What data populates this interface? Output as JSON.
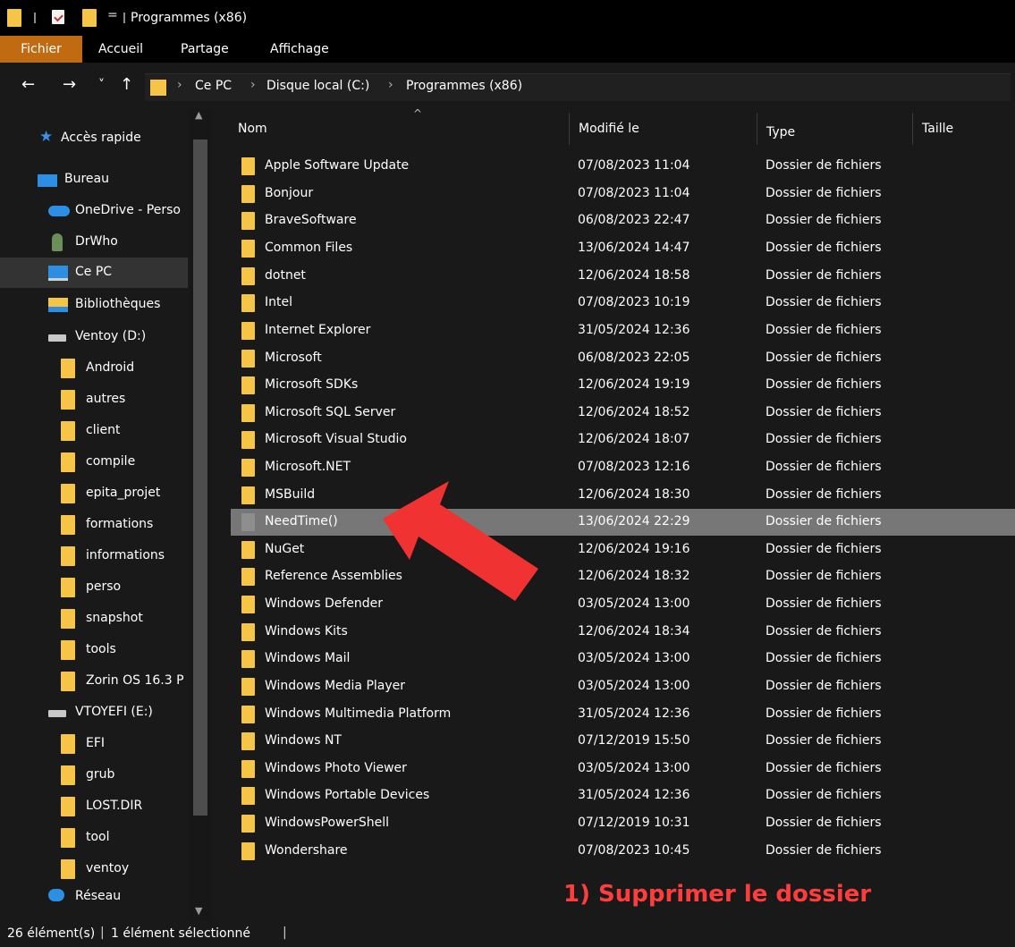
{
  "window": {
    "title": "Programmes (x86)",
    "qa_dropdown": "="
  },
  "ribbon": {
    "tabs": [
      "Fichier",
      "Accueil",
      "Partage",
      "Affichage"
    ]
  },
  "nav": {
    "back": "←",
    "forward": "→",
    "recent": "˅",
    "up": "↑"
  },
  "address": {
    "crumbs": [
      "Ce PC",
      "Disque local (C:)",
      "Programmes (x86)"
    ],
    "separator": "›"
  },
  "sidebar": {
    "items": [
      {
        "label": "Accès rapide",
        "icon": "star-icon"
      },
      {
        "label": "Bureau",
        "icon": "desktop-icon"
      },
      {
        "label": "OneDrive - Perso",
        "icon": "cloud-icon"
      },
      {
        "label": "DrWho",
        "icon": "user-icon"
      },
      {
        "label": "Ce PC",
        "icon": "computer-icon",
        "selected": true
      },
      {
        "label": "Bibliothèques",
        "icon": "library-icon"
      },
      {
        "label": "Ventoy (D:)",
        "icon": "drive-icon"
      },
      {
        "label": "Android",
        "icon": "folder-icon"
      },
      {
        "label": "autres",
        "icon": "folder-icon"
      },
      {
        "label": "client",
        "icon": "folder-icon"
      },
      {
        "label": "compile",
        "icon": "folder-icon"
      },
      {
        "label": "epita_projet",
        "icon": "folder-icon"
      },
      {
        "label": "formations",
        "icon": "folder-icon"
      },
      {
        "label": "informations",
        "icon": "folder-icon"
      },
      {
        "label": "perso",
        "icon": "folder-icon"
      },
      {
        "label": "snapshot",
        "icon": "folder-icon"
      },
      {
        "label": "tools",
        "icon": "folder-icon"
      },
      {
        "label": "Zorin OS 16.3 P",
        "icon": "folder-icon"
      },
      {
        "label": "VTOYEFI (E:)",
        "icon": "drive-icon"
      },
      {
        "label": "EFI",
        "icon": "folder-icon"
      },
      {
        "label": "grub",
        "icon": "folder-icon"
      },
      {
        "label": "LOST.DIR",
        "icon": "folder-icon"
      },
      {
        "label": "tool",
        "icon": "folder-icon"
      },
      {
        "label": "ventoy",
        "icon": "folder-icon"
      },
      {
        "label": "Réseau",
        "icon": "network-icon"
      }
    ]
  },
  "columns": {
    "name": "Nom",
    "modified": "Modifié le",
    "type": "Type",
    "size": "Taille"
  },
  "files": [
    {
      "name": "Apple Software Update",
      "date": "07/08/2023 11:04",
      "type": "Dossier de fichiers"
    },
    {
      "name": "Bonjour",
      "date": "07/08/2023 11:04",
      "type": "Dossier de fichiers"
    },
    {
      "name": "BraveSoftware",
      "date": "06/08/2023 22:47",
      "type": "Dossier de fichiers"
    },
    {
      "name": "Common Files",
      "date": "13/06/2024 14:47",
      "type": "Dossier de fichiers"
    },
    {
      "name": "dotnet",
      "date": "12/06/2024 18:58",
      "type": "Dossier de fichiers"
    },
    {
      "name": "Intel",
      "date": "07/08/2023 10:19",
      "type": "Dossier de fichiers"
    },
    {
      "name": "Internet Explorer",
      "date": "31/05/2024 12:36",
      "type": "Dossier de fichiers"
    },
    {
      "name": "Microsoft",
      "date": "06/08/2023 22:05",
      "type": "Dossier de fichiers"
    },
    {
      "name": "Microsoft SDKs",
      "date": "12/06/2024 19:19",
      "type": "Dossier de fichiers"
    },
    {
      "name": "Microsoft SQL Server",
      "date": "12/06/2024 18:52",
      "type": "Dossier de fichiers"
    },
    {
      "name": "Microsoft Visual Studio",
      "date": "12/06/2024 18:07",
      "type": "Dossier de fichiers"
    },
    {
      "name": "Microsoft.NET",
      "date": "07/08/2023 12:16",
      "type": "Dossier de fichiers"
    },
    {
      "name": "MSBuild",
      "date": "12/06/2024 18:30",
      "type": "Dossier de fichiers"
    },
    {
      "name": "NeedTime()",
      "date": "13/06/2024 22:29",
      "type": "Dossier de fichiers",
      "selected": true
    },
    {
      "name": "NuGet",
      "date": "12/06/2024 19:16",
      "type": "Dossier de fichiers"
    },
    {
      "name": "Reference Assemblies",
      "date": "12/06/2024 18:32",
      "type": "Dossier de fichiers"
    },
    {
      "name": "Windows Defender",
      "date": "03/05/2024 13:00",
      "type": "Dossier de fichiers"
    },
    {
      "name": "Windows Kits",
      "date": "12/06/2024 18:34",
      "type": "Dossier de fichiers"
    },
    {
      "name": "Windows Mail",
      "date": "03/05/2024 13:00",
      "type": "Dossier de fichiers"
    },
    {
      "name": "Windows Media Player",
      "date": "03/05/2024 13:00",
      "type": "Dossier de fichiers"
    },
    {
      "name": "Windows Multimedia Platform",
      "date": "31/05/2024 12:36",
      "type": "Dossier de fichiers"
    },
    {
      "name": "Windows NT",
      "date": "07/12/2019 15:50",
      "type": "Dossier de fichiers"
    },
    {
      "name": "Windows Photo Viewer",
      "date": "03/05/2024 13:00",
      "type": "Dossier de fichiers"
    },
    {
      "name": "Windows Portable Devices",
      "date": "31/05/2024 12:36",
      "type": "Dossier de fichiers"
    },
    {
      "name": "WindowsPowerShell",
      "date": "07/12/2019 10:31",
      "type": "Dossier de fichiers"
    },
    {
      "name": "Wondershare",
      "date": "07/08/2023 10:45",
      "type": "Dossier de fichiers"
    }
  ],
  "annotation": {
    "text": "1) Supprimer le dossier",
    "color": "#ff3d3d"
  },
  "status": {
    "count": "26 élément(s)",
    "selection": "1 élément sélectionné",
    "separator": "|"
  },
  "colors": {
    "folder": "#f6c447",
    "accent_tab": "#c06a12",
    "selection": "#777777"
  }
}
